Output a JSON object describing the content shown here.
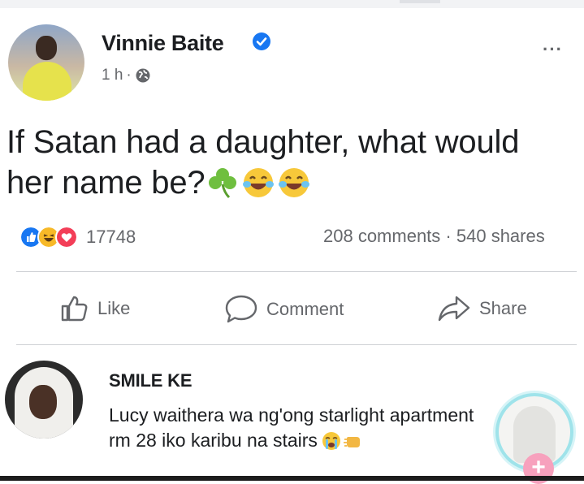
{
  "post": {
    "author": "Vinnie Baite",
    "time": "1 h",
    "time_separator": "·",
    "text_line1": "If Satan had a daughter, what would",
    "text_line2": "her name be?",
    "reaction_count": "17748",
    "comments": "208 comments",
    "stats_separator": "·",
    "shares": "540 shares"
  },
  "actions": {
    "like": "Like",
    "comment": "Comment",
    "share": "Share"
  },
  "comment": {
    "name": "SMILE KE",
    "text_line1": "Lucy waithera wa ng'ong starlight apartment",
    "text_line2": "rm 28 iko karibu na stairs"
  },
  "icons": {
    "verified": "verified-badge-icon",
    "privacy": "globe-icon",
    "more": "more-options-icon",
    "emoji_post": [
      "shamrock-icon",
      "laughing-crying-icon",
      "laughing-crying-icon"
    ],
    "emoji_comment": [
      "loudly-crying-icon",
      "fist-bump-icon"
    ],
    "reactions": [
      "like-reaction-icon",
      "haha-reaction-icon",
      "love-reaction-icon"
    ]
  },
  "colors": {
    "facebook_blue": "#1877f2",
    "muted_text": "#65676b",
    "love_red": "#f33e58",
    "haha_yellow": "#f7b928"
  }
}
